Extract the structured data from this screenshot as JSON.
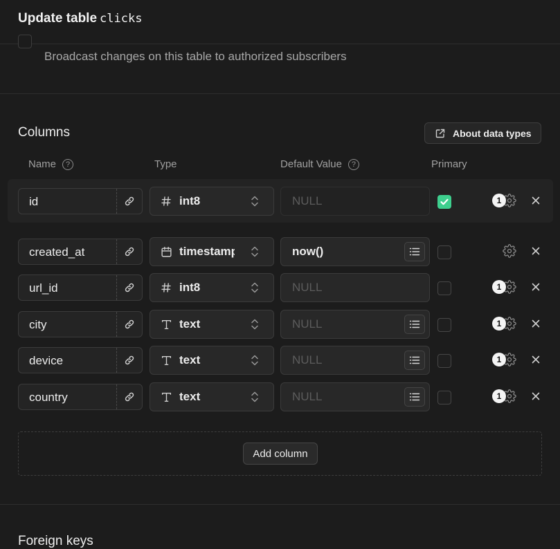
{
  "header": {
    "title_prefix": "Update table",
    "table_name": "clicks"
  },
  "realtime": {
    "description": "Broadcast changes on this table to authorized subscribers"
  },
  "columns_section": {
    "title": "Columns",
    "about_button": "About data types",
    "headers": {
      "name": "Name",
      "type": "Type",
      "default_value": "Default Value",
      "primary": "Primary"
    },
    "help_glyph": "?",
    "rows": [
      {
        "name": "id",
        "type": "int8",
        "type_icon": "hash-icon",
        "default": "NULL",
        "default_is_value": false,
        "default_disabled": true,
        "has_list_button": false,
        "primary": true,
        "badge": "1"
      },
      {
        "name": "created_at",
        "type": "timestamptz",
        "type_icon": "calendar-icon",
        "default": "now()",
        "default_is_value": true,
        "default_disabled": false,
        "has_list_button": true,
        "primary": false,
        "badge": ""
      },
      {
        "name": "url_id",
        "type": "int8",
        "type_icon": "hash-icon",
        "default": "NULL",
        "default_is_value": false,
        "default_disabled": false,
        "has_list_button": false,
        "primary": false,
        "badge": "1"
      },
      {
        "name": "city",
        "type": "text",
        "type_icon": "text-type-icon",
        "default": "NULL",
        "default_is_value": false,
        "default_disabled": false,
        "has_list_button": true,
        "primary": false,
        "badge": "1"
      },
      {
        "name": "device",
        "type": "text",
        "type_icon": "text-type-icon",
        "default": "NULL",
        "default_is_value": false,
        "default_disabled": false,
        "has_list_button": true,
        "primary": false,
        "badge": "1"
      },
      {
        "name": "country",
        "type": "text",
        "type_icon": "text-type-icon",
        "default": "NULL",
        "default_is_value": false,
        "default_disabled": false,
        "has_list_button": true,
        "primary": false,
        "badge": "1"
      }
    ],
    "add_button": "Add column"
  },
  "foreign_keys": {
    "title": "Foreign keys"
  },
  "colors": {
    "background": "#1c1c1c",
    "accent_green": "#3ecf8e",
    "muted_text": "#a8a8a8"
  }
}
